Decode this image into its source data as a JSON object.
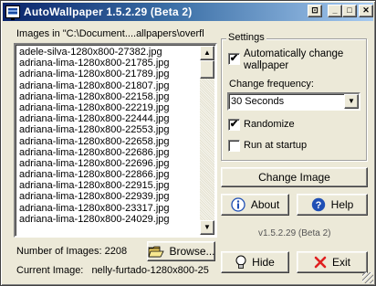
{
  "window": {
    "title": "AutoWallpaper 1.5.2.29 (Beta 2)",
    "controls": {
      "tray": "⊡",
      "minimize": "_",
      "maximize": "□",
      "close": "✕"
    }
  },
  "images": {
    "label": "Images  in  \"C:\\Document....allpapers\\overfl",
    "items": [
      "adele-silva-1280x800-27382.jpg",
      "adriana-lima-1280x800-21785.jpg",
      "adriana-lima-1280x800-21789.jpg",
      "adriana-lima-1280x800-21807.jpg",
      "adriana-lima-1280x800-22158.jpg",
      "adriana-lima-1280x800-22219.jpg",
      "adriana-lima-1280x800-22444.jpg",
      "adriana-lima-1280x800-22553.jpg",
      "adriana-lima-1280x800-22658.jpg",
      "adriana-lima-1280x800-22686.jpg",
      "adriana-lima-1280x800-22696.jpg",
      "adriana-lima-1280x800-22866.jpg",
      "adriana-lima-1280x800-22915.jpg",
      "adriana-lima-1280x800-22939.jpg",
      "adriana-lima-1280x800-23317.jpg",
      "adriana-lima-1280x800-24029.jpg"
    ],
    "count_label": "Number of Images:",
    "count": "2208",
    "current_label": "Current  Image:",
    "current": "nelly-furtado-1280x800-25",
    "browse_label": "Browse..."
  },
  "settings": {
    "group_label": "Settings",
    "auto_change_label": "Automatically change wallpaper",
    "auto_change_checked": true,
    "frequency_label": "Change frequency:",
    "frequency_value": "30 Seconds",
    "randomize_label": "Randomize",
    "randomize_checked": true,
    "startup_label": "Run at startup",
    "startup_checked": false
  },
  "actions": {
    "change_image": "Change Image",
    "about": "About",
    "help": "Help",
    "version": "v1.5.2.29 (Beta 2)",
    "hide": "Hide",
    "exit": "Exit"
  },
  "icons": {
    "app": "monitor-icon",
    "browse": "folder-open-icon",
    "about": "info-icon",
    "help": "question-icon",
    "hide": "lightbulb-icon",
    "exit": "red-x-icon"
  },
  "colors": {
    "titlebar_start": "#0a246a",
    "titlebar_end": "#a6caf0",
    "face": "#ece9d8",
    "exit_x": "#e02020",
    "info_blue": "#1f4fb5"
  }
}
